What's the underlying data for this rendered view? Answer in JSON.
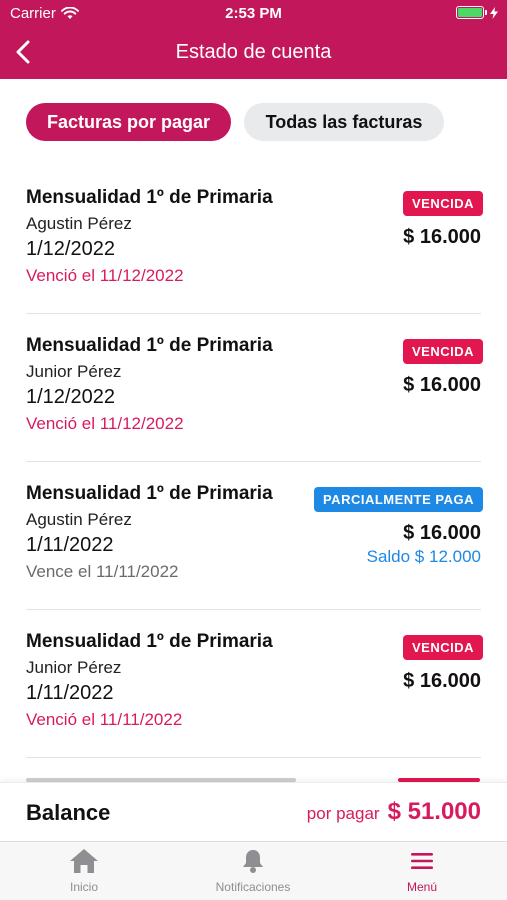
{
  "status_bar": {
    "carrier": "Carrier",
    "time": "2:53 PM"
  },
  "header": {
    "title": "Estado de cuenta",
    "back_icon": "chevron-left-icon"
  },
  "filters": [
    {
      "label": "Facturas por pagar",
      "active": true
    },
    {
      "label": "Todas las facturas",
      "active": false
    }
  ],
  "invoices": [
    {
      "title": "Mensualidad 1º de Primaria",
      "student": "Agustin Pérez",
      "date": "1/12/2022",
      "due_text": "Venció el 11/12/2022",
      "due_state": "overdue",
      "badge": "VENCIDA",
      "badge_type": "overdue",
      "amount": "$ 16.000",
      "balance": ""
    },
    {
      "title": "Mensualidad 1º de Primaria",
      "student": "Junior Pérez",
      "date": "1/12/2022",
      "due_text": "Venció el 11/12/2022",
      "due_state": "overdue",
      "badge": "VENCIDA",
      "badge_type": "overdue",
      "amount": "$ 16.000",
      "balance": ""
    },
    {
      "title": "Mensualidad 1º de Primaria",
      "student": "Agustin Pérez",
      "date": "1/11/2022",
      "due_text": "Vence el 11/11/2022",
      "due_state": "normal",
      "badge": "PARCIALMENTE PAGA",
      "badge_type": "partial",
      "amount": "$ 16.000",
      "balance": "Saldo $ 12.000"
    },
    {
      "title": "Mensualidad 1º de Primaria",
      "student": "Junior Pérez",
      "date": "1/11/2022",
      "due_text": "Venció el 11/11/2022",
      "due_state": "overdue",
      "badge": "VENCIDA",
      "badge_type": "overdue",
      "amount": "$ 16.000",
      "balance": ""
    }
  ],
  "balance": {
    "label": "Balance",
    "caption": "por pagar",
    "amount": "$ 51.000"
  },
  "tabs": [
    {
      "label": "Inicio",
      "icon": "home-icon",
      "active": false
    },
    {
      "label": "Notificaciones",
      "icon": "bell-icon",
      "active": false
    },
    {
      "label": "Menú",
      "icon": "menu-icon",
      "active": true
    }
  ],
  "colors": {
    "brand": "#C2185B",
    "overdue": "#E3174F",
    "partial": "#1E88E5"
  }
}
